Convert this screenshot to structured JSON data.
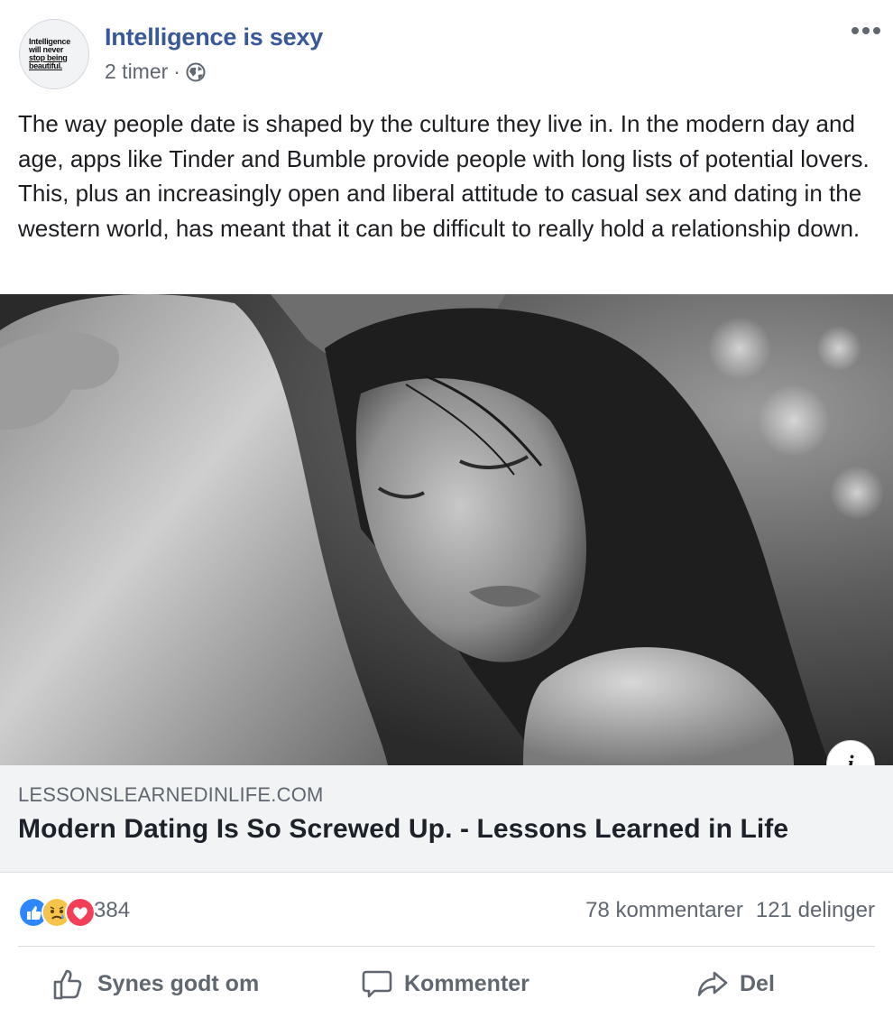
{
  "post": {
    "page_name": "Intelligence is sexy",
    "avatar_text": [
      "Intelligence",
      "will never",
      "stop being",
      "beautiful."
    ],
    "time": "2 timer",
    "separator": "·",
    "privacy_icon": "globe-icon",
    "more_icon": "more-options-icon",
    "body": "The way people date is shaped by the culture they live in. In the modern day and age, apps like Tinder and Bumble provide people with long lists of potential lovers. This, plus an increasingly open and liberal attitude to casual sex and dating in the western world, has meant that it can be difficult to really hold a relationship down."
  },
  "link_preview": {
    "domain": "LESSONSLEARNEDINLIFE.COM",
    "title": "Modern Dating Is So Screwed Up. - Lessons Learned in Life",
    "info_label": "i"
  },
  "stats": {
    "reaction_icons": [
      "like-reaction-icon",
      "sad-reaction-icon",
      "love-reaction-icon"
    ],
    "reaction_count": "384",
    "comments": "78 kommentarer",
    "shares": "121 delinger"
  },
  "actions": {
    "like": "Synes godt om",
    "comment": "Kommenter",
    "share": "Del"
  },
  "colors": {
    "page_name": "#385898",
    "meta": "#606770",
    "link_bg": "#f2f3f5",
    "like_blue": "#2d88ff",
    "love_red": "#f33e58",
    "sad_yellow": "#f7c34a"
  }
}
